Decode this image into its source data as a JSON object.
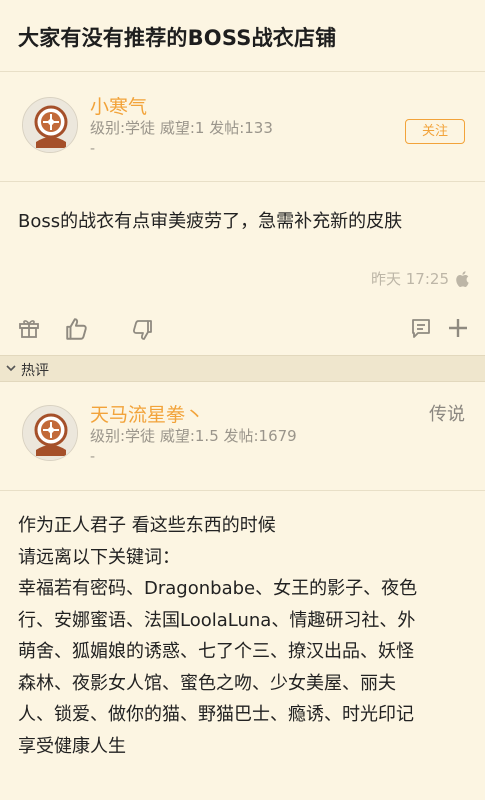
{
  "thread": {
    "title": "大家有没有推荐的BOSS战衣店铺"
  },
  "post": {
    "author": {
      "name": "小寒气",
      "meta": "级别:学徒 威望:1 发帖:133",
      "signature": "-"
    },
    "follow_label": "关注",
    "content": "Boss的战衣有点审美疲劳了，急需补充新的皮肤",
    "time": "昨天 17:25",
    "device_icon": "apple-icon",
    "actions": [
      "gift-icon",
      "thumbs-up-icon",
      "thumbs-down-icon",
      "comment-icon",
      "plus-icon"
    ]
  },
  "hot_section": {
    "label": "热评",
    "icon": "chevron-down-icon"
  },
  "reply": {
    "author": {
      "name": "天马流星拳丶",
      "meta": "级别:学徒 威望:1.5 发帖:1679",
      "signature": "-"
    },
    "rank": "传说",
    "lines": [
      "作为正人君子 看这些东西的时候",
      "请远离以下关键词：",
      "幸福若有密码、Dragonbabe、女王的影子、夜色",
      "行、安娜蜜语、法国LoolaLuna、情趣研习社、外",
      "萌舍、狐媚娘的诱惑、七了个三、撩汉出品、妖怪",
      "森林、夜影女人馆、蜜色之吻、少女美屋、丽夫",
      "人、锁爱、做你的猫、野猫巴士、瘾诱、时光印记",
      "享受健康人生"
    ]
  },
  "colors": {
    "background": "#fcf5e2",
    "accent": "#f2a33a",
    "section_bar": "#efe6cd",
    "muted": "#9a958b"
  }
}
